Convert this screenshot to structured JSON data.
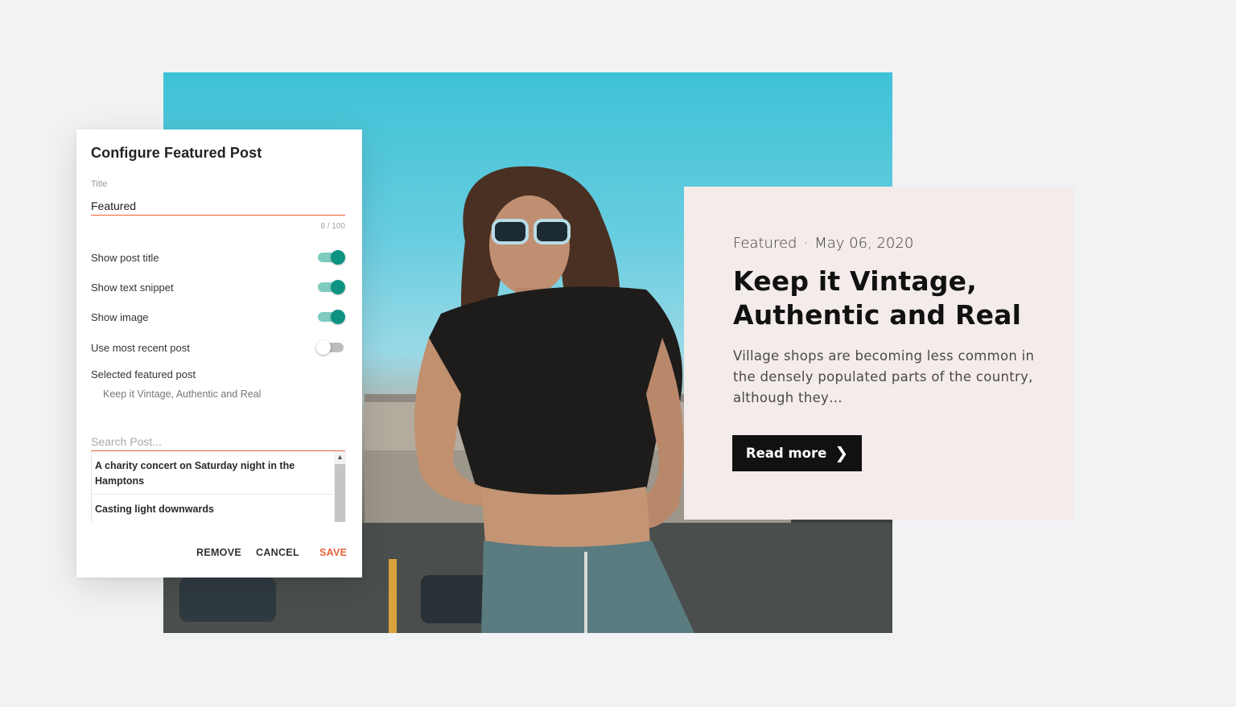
{
  "dialog": {
    "title": "Configure Featured Post",
    "title_field_label": "Title",
    "title_value": "Featured",
    "char_counter": "8 / 100",
    "toggles": [
      {
        "label": "Show post title",
        "on": true
      },
      {
        "label": "Show text snippet",
        "on": true
      },
      {
        "label": "Show image",
        "on": true
      },
      {
        "label": "Use most recent post",
        "on": false
      }
    ],
    "selected_label": "Selected featured post",
    "selected_value": "Keep it Vintage, Authentic and Real",
    "search_placeholder": "Search Post...",
    "results": [
      "A charity concert on Saturday night in the Hamptons",
      "Casting light downwards"
    ],
    "actions": {
      "remove": "REMOVE",
      "cancel": "CANCEL",
      "save": "SAVE"
    }
  },
  "card": {
    "category": "Featured",
    "separator": "·",
    "date": "May 06, 2020",
    "title": "Keep it Vintage, Authentic and Real",
    "snippet": "Village shops are becoming less common in the densely populated parts of the country, although they…",
    "button_label": "Read more"
  },
  "colors": {
    "accent": "#e8643a",
    "toggle_on": "#0e9382",
    "card_bg": "#f4ecea",
    "button_bg": "#111111"
  }
}
